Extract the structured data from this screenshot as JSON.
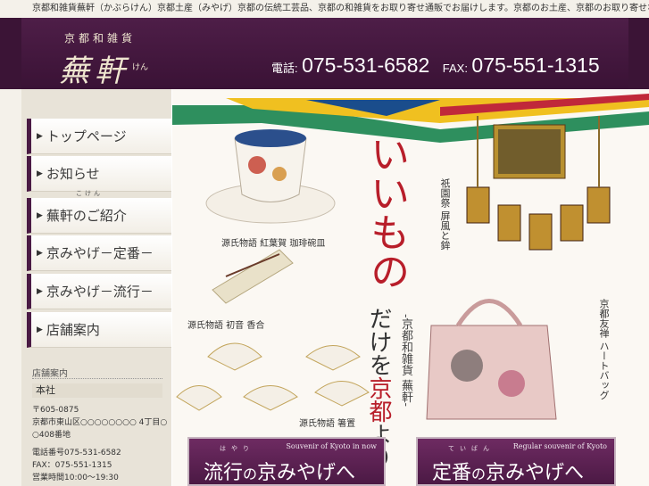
{
  "topbar": {
    "text": "京都和雑貨蕪軒（かぶらけん）京都土産（みやげ）京都の伝統工芸品、京都の和雑貨をお取り寄せ通販でお届けします。京都のお土産、京都のお取り寄せなら蕪軒"
  },
  "header": {
    "subtitle": "京都和雑貨",
    "logo": "蕪軒",
    "logo_kana": "けん",
    "phone_label": "電話:",
    "phone": "075-531-6582",
    "fax_label": "FAX:",
    "fax": "075-551-1315"
  },
  "nav": {
    "items": [
      {
        "label": "トップページ"
      },
      {
        "label": "お知らせ"
      },
      {
        "label": "蕪軒のご紹介",
        "ruby": "こけん"
      },
      {
        "label": "京みやげ－定番－"
      },
      {
        "label": "京みやげ－流行－"
      },
      {
        "label": "店舗案内"
      }
    ]
  },
  "store": {
    "heading": "店舗案内",
    "branch": "本社",
    "postal": "〒605-0875",
    "address1": "京都市東山区○○○○○○○○ 4丁目○",
    "address2": "○408番地",
    "tel": "電話番号075-531-6582",
    "fax": "FAX：075-551-1315",
    "hours": "営業時間10:00～19:30"
  },
  "hero": {
    "headline": "いいもの",
    "headline2a": "だけを",
    "headline2b": "京都",
    "headline2c": "より",
    "subline": "-京都和雑貨 蕪軒-",
    "label_gion": "祇園祭 屏風と鉾",
    "label_yuzen": "京都友禅 ハートバッグ",
    "label_cup": "源氏物語 紅葉賀 珈琲碗皿",
    "label_incense": "源氏物語 初音 香合",
    "label_chopstick": "源氏物語 箸置"
  },
  "banners": {
    "trend": {
      "sub": "Souvenir of Kyoto in now",
      "ruby": "はやり",
      "main": "流行",
      "small": "の",
      "rest": "京みやげへ"
    },
    "standard": {
      "sub": "Regular souvenir of Kyoto",
      "ruby": "ていばん",
      "main": "定番",
      "small": "の",
      "rest": "京みやげへ"
    }
  }
}
